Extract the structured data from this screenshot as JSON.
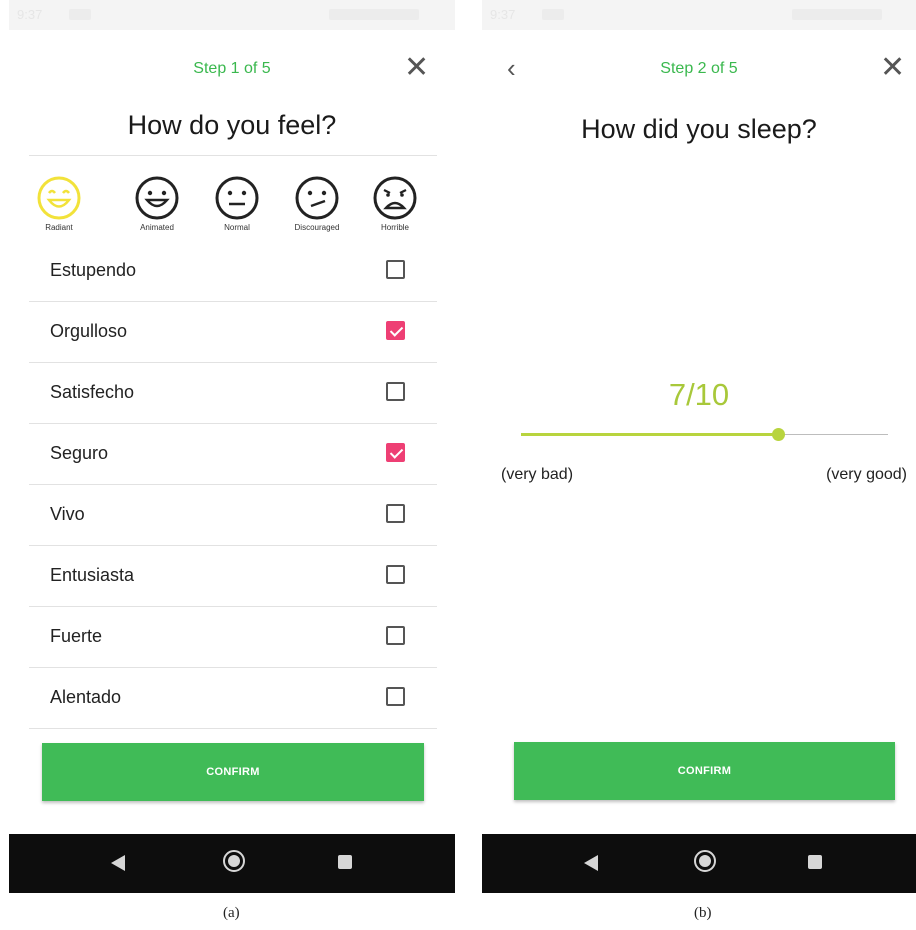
{
  "screen_a": {
    "status_time": "9:37",
    "step": "Step 1 of 5",
    "close_glyph": "✕",
    "question": "How do you feel?",
    "moods": [
      {
        "label": "Radiant",
        "icon": "radiant-face-icon",
        "selected": true
      },
      {
        "label": "Animated",
        "icon": "animated-face-icon",
        "selected": false
      },
      {
        "label": "Normal",
        "icon": "normal-face-icon",
        "selected": false
      },
      {
        "label": "Discouraged",
        "icon": "discouraged-face-icon",
        "selected": false
      },
      {
        "label": "Horrible",
        "icon": "horrible-face-icon",
        "selected": false
      }
    ],
    "feelings": [
      {
        "label": "Estupendo",
        "checked": false
      },
      {
        "label": "Orgulloso",
        "checked": true
      },
      {
        "label": "Satisfecho",
        "checked": false
      },
      {
        "label": "Seguro",
        "checked": true
      },
      {
        "label": "Vivo",
        "checked": false
      },
      {
        "label": "Entusiasta",
        "checked": false
      },
      {
        "label": "Fuerte",
        "checked": false
      },
      {
        "label": "Alentado",
        "checked": false
      }
    ],
    "confirm_label": "CONFIRM",
    "caption": "(a)"
  },
  "screen_b": {
    "status_time": "9:37",
    "back_glyph": "‹",
    "step": "Step 2 of 5",
    "close_glyph": "✕",
    "question": "How did you sleep?",
    "score_text": "7/10",
    "slider": {
      "value": 7,
      "min": 0,
      "max": 10
    },
    "min_label": "(very bad)",
    "max_label": "(very good)",
    "confirm_label": "CONFIRM",
    "caption": "(b)"
  },
  "colors": {
    "accent_green": "#3ab84e",
    "confirm_green": "#40bb57",
    "checkbox_pink": "#ee3f74",
    "slider_lime": "#b8d43e",
    "radiant_yellow": "#f2e23a"
  }
}
